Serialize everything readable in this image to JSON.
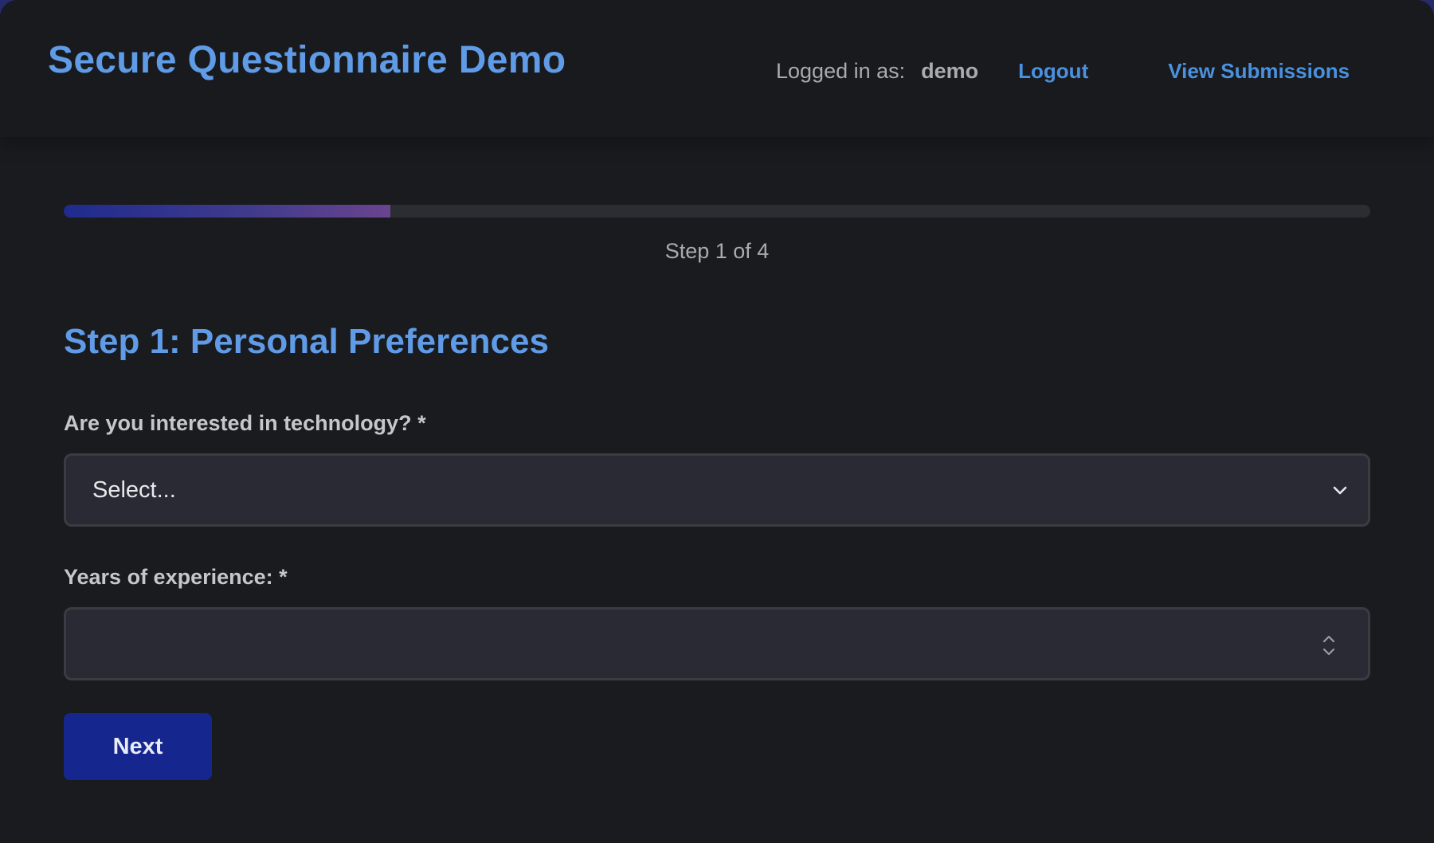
{
  "header": {
    "title": "Secure Questionnaire Demo",
    "logged_in_label": "Logged in as:",
    "username": "demo",
    "logout_label": "Logout",
    "view_submissions_label": "View Submissions"
  },
  "progress": {
    "current_step": 1,
    "total_steps": 4,
    "fill_fraction": 0.25,
    "indicator_text": "Step 1 of 4"
  },
  "form": {
    "step_heading": "Step 1: Personal Preferences",
    "tech_question": {
      "label": "Are you interested in technology? *",
      "selected_value": "Select..."
    },
    "experience_question": {
      "label": "Years of experience: *",
      "value": ""
    },
    "next_label": "Next"
  },
  "icons": {
    "select_arrow": "chevron-down-icon",
    "number_spinner": "spinner-icon"
  },
  "colors": {
    "accent_title": "#5f9be6",
    "link": "#4a91e0",
    "button": "#15278f",
    "background": "#1a1b1e"
  }
}
